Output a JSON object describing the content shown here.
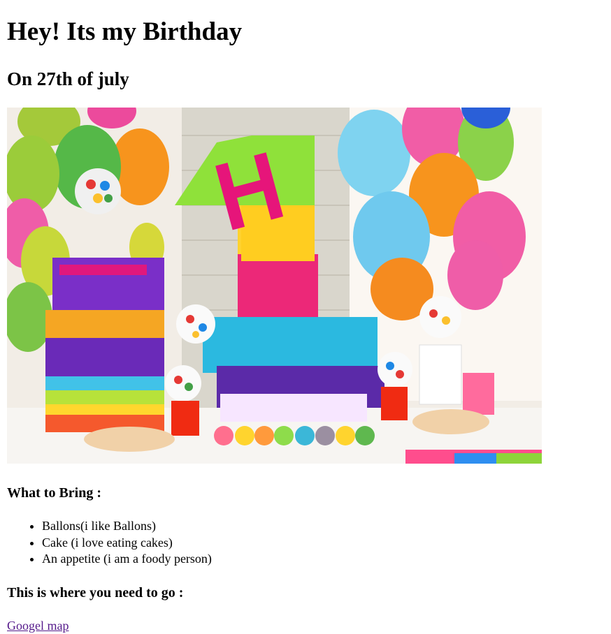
{
  "page": {
    "title": "Hey! Its my Birthday",
    "subtitle": "On 27th of july"
  },
  "image": {
    "icon": "birthday-party-photo"
  },
  "bring": {
    "heading": "What to Bring :",
    "items": [
      "Ballons(i like Ballons)",
      "Cake (i love eating cakes)",
      "An appetite (i am a foody person)"
    ]
  },
  "directions": {
    "heading": "This is where you need to go :",
    "link_text": "Googel map"
  },
  "colors": {
    "link_visited": "#551a8b"
  }
}
